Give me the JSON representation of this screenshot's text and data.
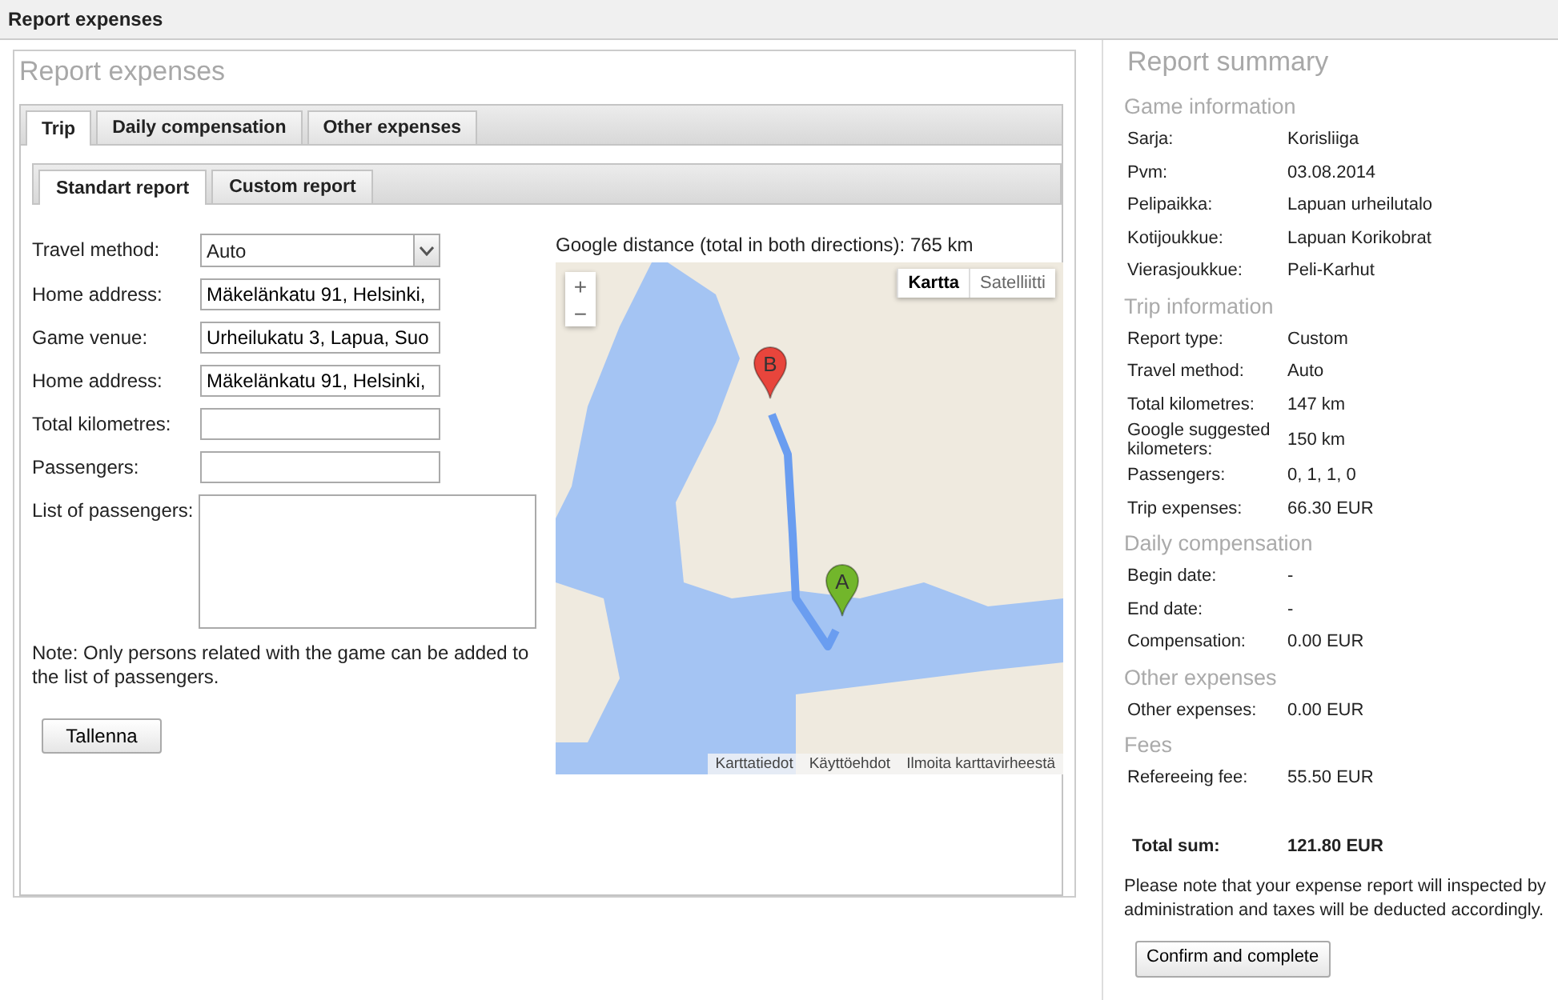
{
  "window": {
    "title": "Report expenses"
  },
  "report": {
    "heading": "Report expenses",
    "tabs": [
      {
        "label": "Trip",
        "selected": true
      },
      {
        "label": "Daily compensation",
        "selected": false
      },
      {
        "label": "Other expenses",
        "selected": false
      }
    ],
    "subtabs": [
      {
        "label": "Standart report",
        "selected": true
      },
      {
        "label": "Custom report",
        "selected": false
      }
    ],
    "fields": [
      {
        "kind": "select",
        "label": "Travel method:",
        "value": "Auto"
      },
      {
        "kind": "text",
        "label": "Home address:",
        "value": "Mäkelänkatu 91, Helsinki,"
      },
      {
        "kind": "text",
        "label": "Game venue:",
        "value": "Urheilukatu 3, Lapua, Suo"
      },
      {
        "kind": "text",
        "label": "Home address:",
        "value": "Mäkelänkatu 91, Helsinki,"
      },
      {
        "kind": "text",
        "label": "Total kilometres:"
      },
      {
        "kind": "text",
        "label": "Passengers:"
      },
      {
        "kind": "textarea",
        "label": "List of passengers:"
      }
    ],
    "note": "Note: Only persons related with the game can be added to the list of passengers.",
    "save_button": "Tallenna",
    "map": {
      "distance": "Google distance (total in both directions): 765 km",
      "zoom_in": "+",
      "zoom_out": "−",
      "map_types": [
        {
          "label": "Kartta",
          "selected": true
        },
        {
          "label": "Satelliitti",
          "selected": false
        }
      ],
      "markers": [
        {
          "label": "B",
          "color": "#e8453c"
        },
        {
          "label": "A",
          "color": "#72b62b"
        }
      ],
      "footer_links": [
        "Karttatiedot",
        "Käyttöehdot",
        "Ilmoita karttavirheestä"
      ]
    }
  },
  "summary": {
    "heading": "Report summary",
    "sections": [
      {
        "title": "Game information",
        "rows": [
          {
            "label": "Sarja:",
            "value": "Korisliiga"
          },
          {
            "label": "Pvm:",
            "value": "03.08.2014"
          },
          {
            "label": "Pelipaikka:",
            "value": "Lapuan urheilutalo"
          },
          {
            "label": "Kotijoukkue:",
            "value": "Lapuan Korikobrat"
          },
          {
            "label": "Vierasjoukkue:",
            "value": "Peli-Karhut"
          }
        ]
      },
      {
        "title": "Trip information",
        "rows": [
          {
            "label": "Report type:",
            "value": "Custom"
          },
          {
            "label": "Travel method:",
            "value": "Auto"
          },
          {
            "label": "Total kilometres:",
            "value": "147 km"
          },
          {
            "label": "Google suggested kilometers:",
            "value": "150 km"
          },
          {
            "label": "Passengers:",
            "value": "0, 1, 1, 0"
          },
          {
            "label": "Trip expenses:",
            "value": "66.30 EUR"
          }
        ]
      },
      {
        "title": "Daily compensation",
        "rows": [
          {
            "label": "Begin date:",
            "value": "-"
          },
          {
            "label": "End date:",
            "value": "-"
          },
          {
            "label": "Compensation:",
            "value": "0.00 EUR"
          }
        ]
      },
      {
        "title": "Other expenses",
        "rows": [
          {
            "label": "Other expenses:",
            "value": "0.00 EUR"
          }
        ]
      },
      {
        "title": "Fees",
        "rows": [
          {
            "label": "Refereeing fee:",
            "value": "55.50 EUR"
          }
        ]
      }
    ],
    "total": {
      "label": "Total sum:",
      "value": "121.80 EUR"
    },
    "note": "Please note that your expense report will inspected by administration and taxes will be deducted accordingly.",
    "confirm_button": "Confirm and complete"
  }
}
